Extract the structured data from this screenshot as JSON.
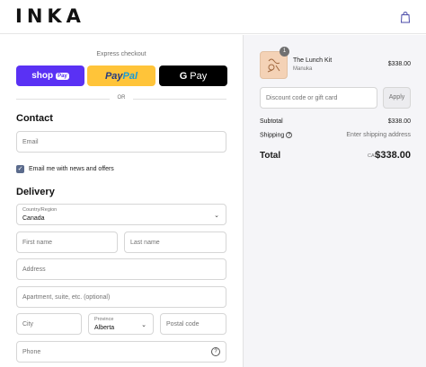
{
  "header": {
    "logo": "INKA",
    "cart_icon": "shopping-bag-icon"
  },
  "express": {
    "label": "Express checkout",
    "shop_pay": "shop",
    "shop_pay_badge": "Pay",
    "paypal_a": "Pay",
    "paypal_b": "Pal",
    "gpay_g": "G",
    "gpay_text": "Pay",
    "or": "OR"
  },
  "contact": {
    "title": "Contact",
    "email_placeholder": "Email",
    "newsletter_label": "Email me with news and offers",
    "newsletter_checked": true
  },
  "delivery": {
    "title": "Delivery",
    "country_label": "Country/Region",
    "country_value": "Canada",
    "first_name_placeholder": "First name",
    "last_name_placeholder": "Last name",
    "address_placeholder": "Address",
    "apartment_placeholder": "Apartment, suite, etc. (optional)",
    "city_placeholder": "City",
    "province_label": "Province",
    "province_value": "Alberta",
    "postal_placeholder": "Postal code",
    "phone_placeholder": "Phone"
  },
  "summary": {
    "product": {
      "name": "The Lunch Kit",
      "variant": "Manuka",
      "price": "$338.00",
      "quantity": "1"
    },
    "discount_placeholder": "Discount code or gift card",
    "apply_label": "Apply",
    "subtotal_label": "Subtotal",
    "subtotal_value": "$338.00",
    "shipping_label": "Shipping",
    "shipping_value": "Enter shipping address",
    "total_label": "Total",
    "total_currency": "CAD",
    "total_value": "$338.00"
  },
  "colors": {
    "shop_pay": "#5a31f4",
    "paypal": "#ffc439",
    "gpay": "#000000",
    "summary_bg": "#f5f5f8"
  }
}
